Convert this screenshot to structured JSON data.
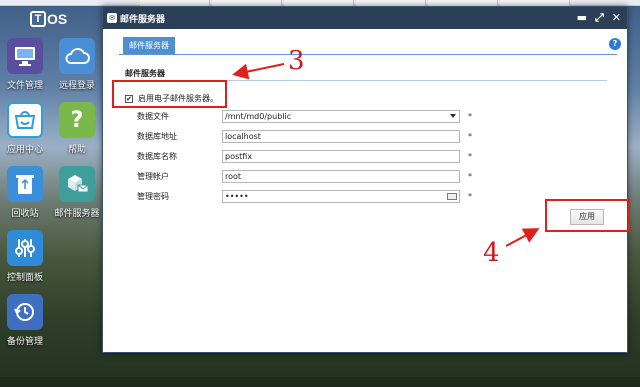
{
  "desktop": {
    "logo_text": "OS",
    "logo_letter": "T",
    "icons": [
      {
        "label": "文件管理",
        "icon": "monitor-icon",
        "color": "#5a4ea0"
      },
      {
        "label": "远程登录",
        "icon": "cloud-icon",
        "color": "#4a8fd6"
      },
      {
        "label": "应用中心",
        "icon": "app-center-icon",
        "color": "#2f9fd8"
      },
      {
        "label": "帮助",
        "icon": "help-icon",
        "color": "#7ab84a"
      },
      {
        "label": "回收站",
        "icon": "recycle-icon",
        "color": "#3a8fd8"
      },
      {
        "label": "邮件服务器",
        "icon": "mail-server-icon",
        "color": "#3d9e9a"
      },
      {
        "label": "控制面板",
        "icon": "control-panel-icon",
        "color": "#2f8ad8"
      },
      {
        "label": "备份管理",
        "icon": "backup-icon",
        "color": "#3f6fc0"
      }
    ]
  },
  "window": {
    "title": "邮件服务器",
    "tab": "邮件服务器",
    "help_glyph": "?",
    "section_title": "邮件服务器",
    "enable_label": "启用电子邮件服务器。",
    "enable_checked": true,
    "fields": [
      {
        "label": "数据文件",
        "value": "/mnt/md0/public",
        "type": "select"
      },
      {
        "label": "数据库地址",
        "value": "localhost",
        "type": "text"
      },
      {
        "label": "数据库名称",
        "value": "postfix",
        "type": "text"
      },
      {
        "label": "管理帐户",
        "value": "root",
        "type": "text"
      },
      {
        "label": "管理密码",
        "value": "•••••",
        "type": "password"
      }
    ],
    "required_mark": "*",
    "apply_label": "应用"
  },
  "annotations": {
    "three": "3",
    "four": "4",
    "color": "#e0201c"
  }
}
